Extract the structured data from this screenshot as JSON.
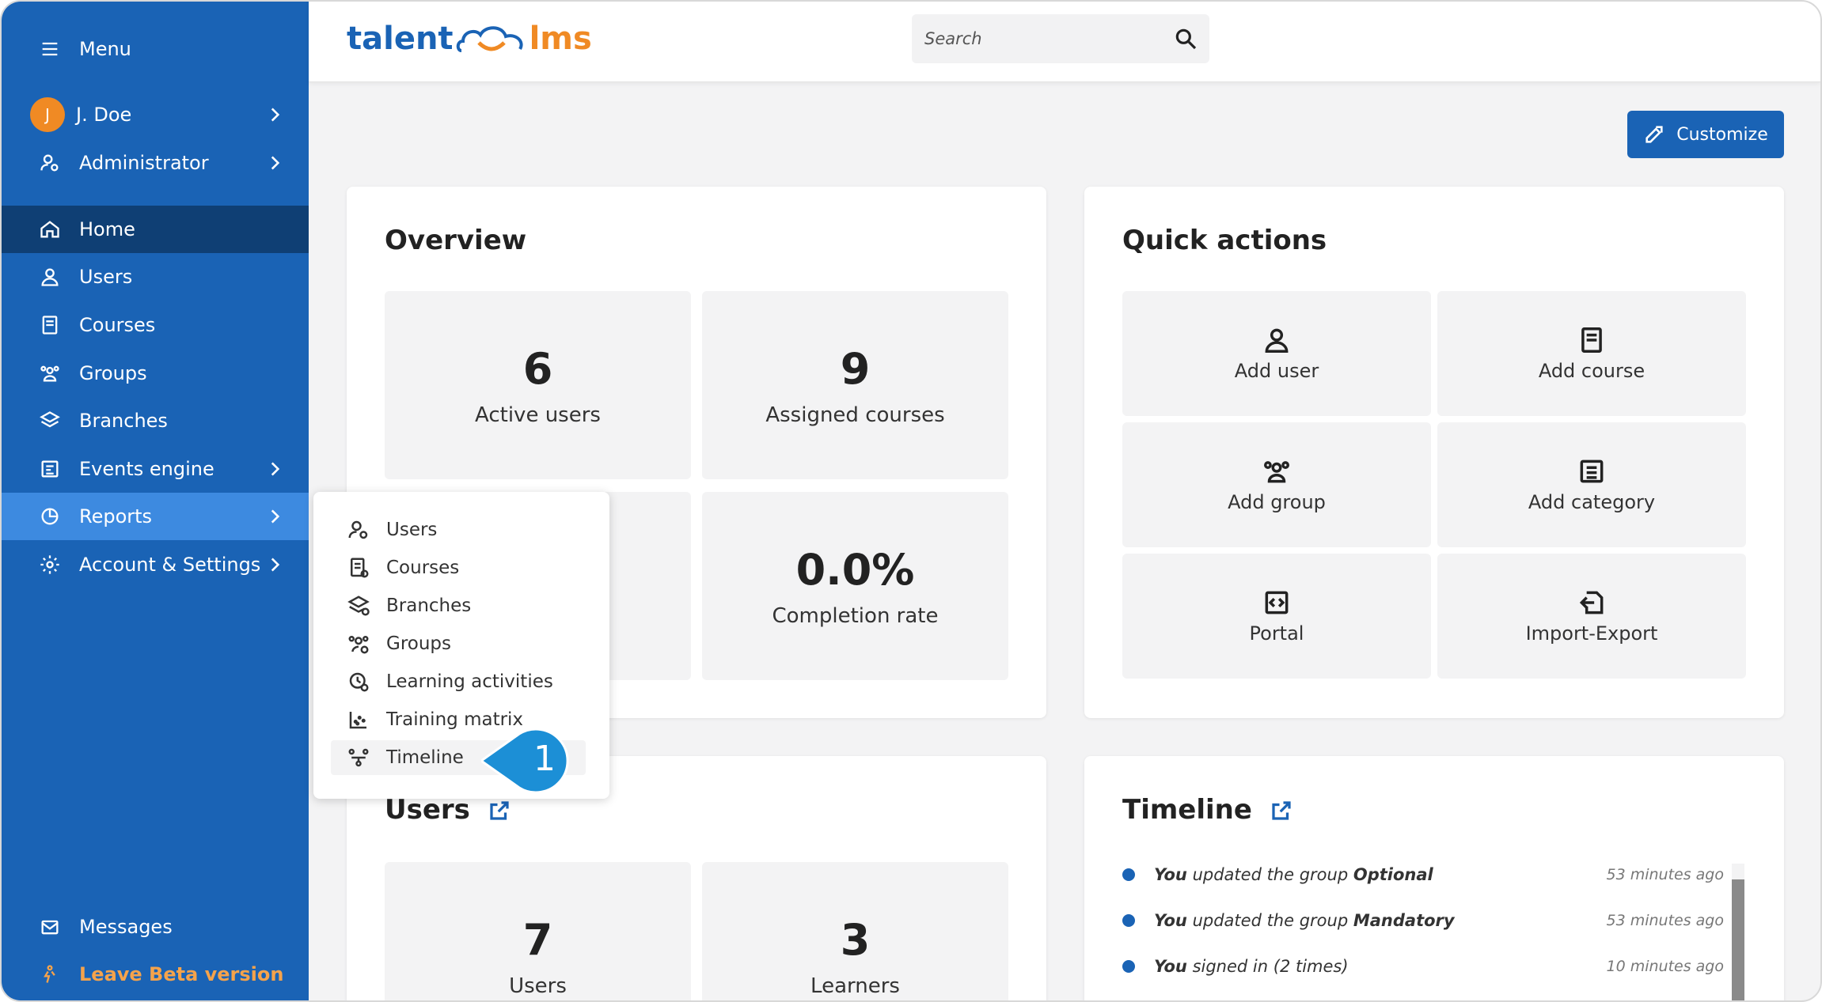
{
  "sidebar": {
    "menu_label": "Menu",
    "user": {
      "initial": "J",
      "name": "J. Doe"
    },
    "role": "Administrator",
    "items": [
      {
        "label": "Home"
      },
      {
        "label": "Users"
      },
      {
        "label": "Courses"
      },
      {
        "label": "Groups"
      },
      {
        "label": "Branches"
      },
      {
        "label": "Events engine"
      },
      {
        "label": "Reports"
      },
      {
        "label": "Account & Settings"
      }
    ],
    "messages": "Messages",
    "leave_beta": "Leave Beta version"
  },
  "header": {
    "logo_left": "talent",
    "logo_right": "lms",
    "search_placeholder": "Search"
  },
  "customize_label": "Customize",
  "overview": {
    "title": "Overview",
    "tiles": [
      {
        "value": "6",
        "label": "Active users"
      },
      {
        "value": "9",
        "label": "Assigned courses"
      },
      {
        "value": "0.0%",
        "label": "Completion rate"
      }
    ]
  },
  "quick_actions": {
    "title": "Quick actions",
    "items": [
      {
        "label": "Add user",
        "icon": "user-icon"
      },
      {
        "label": "Add course",
        "icon": "book-icon"
      },
      {
        "label": "Add group",
        "icon": "group-icon"
      },
      {
        "label": "Add category",
        "icon": "list-icon"
      },
      {
        "label": "Portal",
        "icon": "code-icon"
      },
      {
        "label": "Import-Export",
        "icon": "import-icon"
      }
    ]
  },
  "reports_menu": {
    "items": [
      {
        "label": "Users"
      },
      {
        "label": "Courses"
      },
      {
        "label": "Branches"
      },
      {
        "label": "Groups"
      },
      {
        "label": "Learning activities"
      },
      {
        "label": "Training matrix"
      },
      {
        "label": "Timeline"
      }
    ],
    "callout_number": "1"
  },
  "users_card": {
    "title": "Users",
    "tiles": [
      {
        "value": "7",
        "label": "Users"
      },
      {
        "value": "3",
        "label": "Learners"
      }
    ]
  },
  "timeline": {
    "title": "Timeline",
    "entries": [
      {
        "actor": "You",
        "action": "updated the group",
        "object": "Optional",
        "time": "53 minutes ago"
      },
      {
        "actor": "You",
        "action": "updated the group",
        "object": "Mandatory",
        "time": "53 minutes ago"
      },
      {
        "actor": "You",
        "action": "signed in",
        "object": "(2 times)",
        "time": "10 minutes ago"
      }
    ]
  },
  "colors": {
    "sidebar": "#1a63b5",
    "active": "#0f3f74",
    "highlight": "#3d8ae0",
    "accent_orange": "#f08a24"
  }
}
